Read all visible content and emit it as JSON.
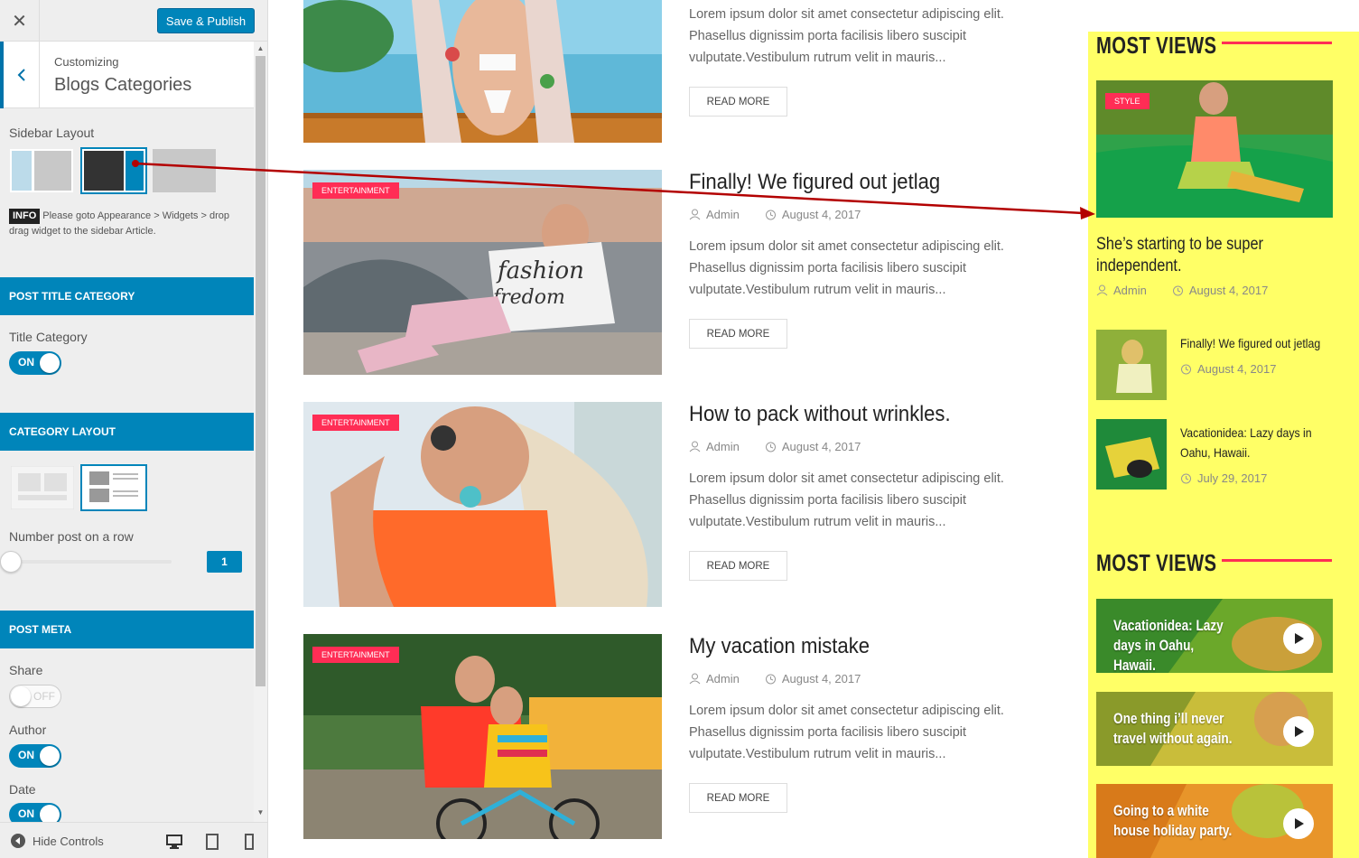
{
  "customizer": {
    "close_label": "✕",
    "publish_label": "Save & Publish",
    "breadcrumb": "Customizing",
    "section_title": "Blogs Categories",
    "sidebar_layout_label": "Sidebar Layout",
    "info_badge": "INFO",
    "info_text": "Please goto Appearance > Widgets > drop drag widget to the sidebar Article.",
    "sections": {
      "post_title_category": "POST TITLE CATEGORY",
      "category_layout": "CATEGORY LAYOUT",
      "post_meta": "POST META"
    },
    "title_category_label": "Title Category",
    "title_category_toggle": "ON",
    "number_post_label": "Number post on a row",
    "number_post_value": "1",
    "share_label": "Share",
    "share_toggle": "OFF",
    "author_label": "Author",
    "author_toggle": "ON",
    "date_label": "Date",
    "date_toggle": "ON",
    "hide_controls": "Hide Controls"
  },
  "posts": [
    {
      "category": "",
      "title": "",
      "author": "",
      "date": "",
      "excerpt": "Lorem ipsum dolor sit amet consectetur adipiscing elit. Phasellus dignissim porta facilisis libero suscipit vulputate.Vestibulum rutrum velit in mauris...",
      "read_more": "READ MORE"
    },
    {
      "category": "ENTERTAINMENT",
      "title": "Finally! We figured out jetlag",
      "author": "Admin",
      "date": "August 4, 2017",
      "excerpt": "Lorem ipsum dolor sit amet consectetur adipiscing elit. Phasellus dignissim porta facilisis libero suscipit vulputate.Vestibulum rutrum velit in mauris...",
      "read_more": "READ MORE"
    },
    {
      "category": "ENTERTAINMENT",
      "title": "How to pack without wrinkles.",
      "author": "Admin",
      "date": "August 4, 2017",
      "excerpt": "Lorem ipsum dolor sit amet consectetur adipiscing elit. Phasellus dignissim porta facilisis libero suscipit vulputate.Vestibulum rutrum velit in mauris...",
      "read_more": "READ MORE"
    },
    {
      "category": "ENTERTAINMENT",
      "title": "My vacation mistake",
      "author": "Admin",
      "date": "August 4, 2017",
      "excerpt": "Lorem ipsum dolor sit amet consectetur adipiscing elit. Phasellus dignissim porta facilisis libero suscipit vulputate.Vestibulum rutrum velit in mauris...",
      "read_more": "READ MORE"
    }
  ],
  "sidebar": {
    "widget_title_1": "MOST VIEWS",
    "featured": {
      "category": "STYLE",
      "title": "She’s starting to be super independent.",
      "author": "Admin",
      "date": "August 4, 2017"
    },
    "small_items": [
      {
        "title": "Finally! We figured out jetlag",
        "date": "August 4, 2017"
      },
      {
        "title": "Vacationidea: Lazy days in Oahu, Hawaii.",
        "date": "July 29, 2017"
      }
    ],
    "widget_title_2": "MOST VIEWS",
    "videos": [
      {
        "title": "Vacationidea: Lazy days in Oahu, Hawaii."
      },
      {
        "title": "One thing i’ll never travel without again."
      },
      {
        "title": "Going to a white house holiday party."
      }
    ]
  },
  "colors": {
    "accent": "#0085ba",
    "badge": "#ff2d55",
    "sidebar_bg": "#ffff66",
    "arrow": "#b30000"
  }
}
